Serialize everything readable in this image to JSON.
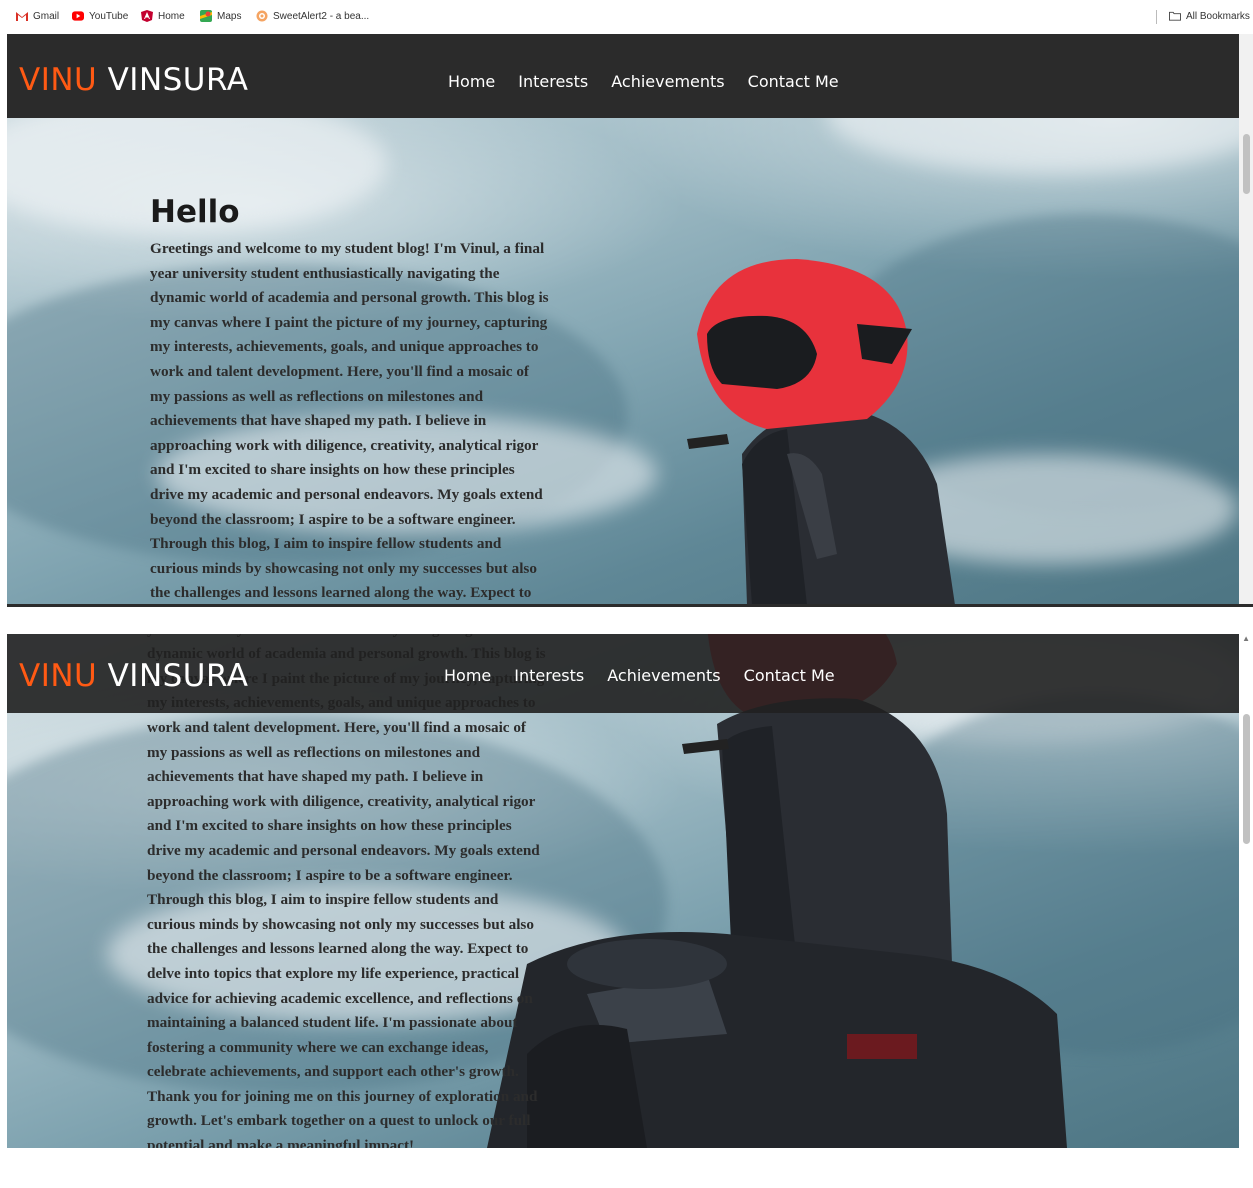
{
  "bookmarks": {
    "items": [
      {
        "label": "Gmail",
        "icon": "gmail-icon"
      },
      {
        "label": "YouTube",
        "icon": "youtube-icon"
      },
      {
        "label": "Home",
        "icon": "angular-icon"
      },
      {
        "label": "Maps",
        "icon": "maps-icon"
      },
      {
        "label": "SweetAlert2 - a bea...",
        "icon": "sweetalert-icon"
      }
    ],
    "all_bookmarks": "All Bookmarks"
  },
  "site": {
    "logo_first": "VINU",
    "logo_second": "VINSURA",
    "nav": [
      "Home",
      "Interests",
      "Achievements",
      "Contact Me"
    ]
  },
  "hero": {
    "title": "Hello",
    "paragraph": "Greetings and welcome to my student blog! I'm Vinul, a final year university student enthusiastically navigating the dynamic world of academia and personal growth. This blog is my canvas where I paint the picture of my journey, capturing my interests, achievements, goals, and unique approaches to work and talent development. Here, you'll find a mosaic of my passions as well as reflections on milestones and achievements that have shaped my path. I believe in approaching work with diligence, creativity, analytical rigor and I'm excited to share insights on how these principles drive my academic and personal endeavors. My goals extend beyond the classroom; I aspire to be a software engineer. Through this blog, I aim to inspire fellow students and curious minds by showcasing not only my successes but also the challenges and lessons learned along the way. Expect to delve into topics that explore my life experience, practical advice for achieving academic excellence, and reflections on maintaining a balanced student life. I'm passionate about fostering a community where we can exchange ideas, celebrate achievements, and support each other's growth. Thank you for joining me on this journey of exploration and growth. Let's embark together on a quest to unlock our full potential and make a meaningful impact!"
  },
  "colors": {
    "accent": "#ff5a14",
    "navbar": "#2b2b2b",
    "helmet": "#e8323c"
  }
}
